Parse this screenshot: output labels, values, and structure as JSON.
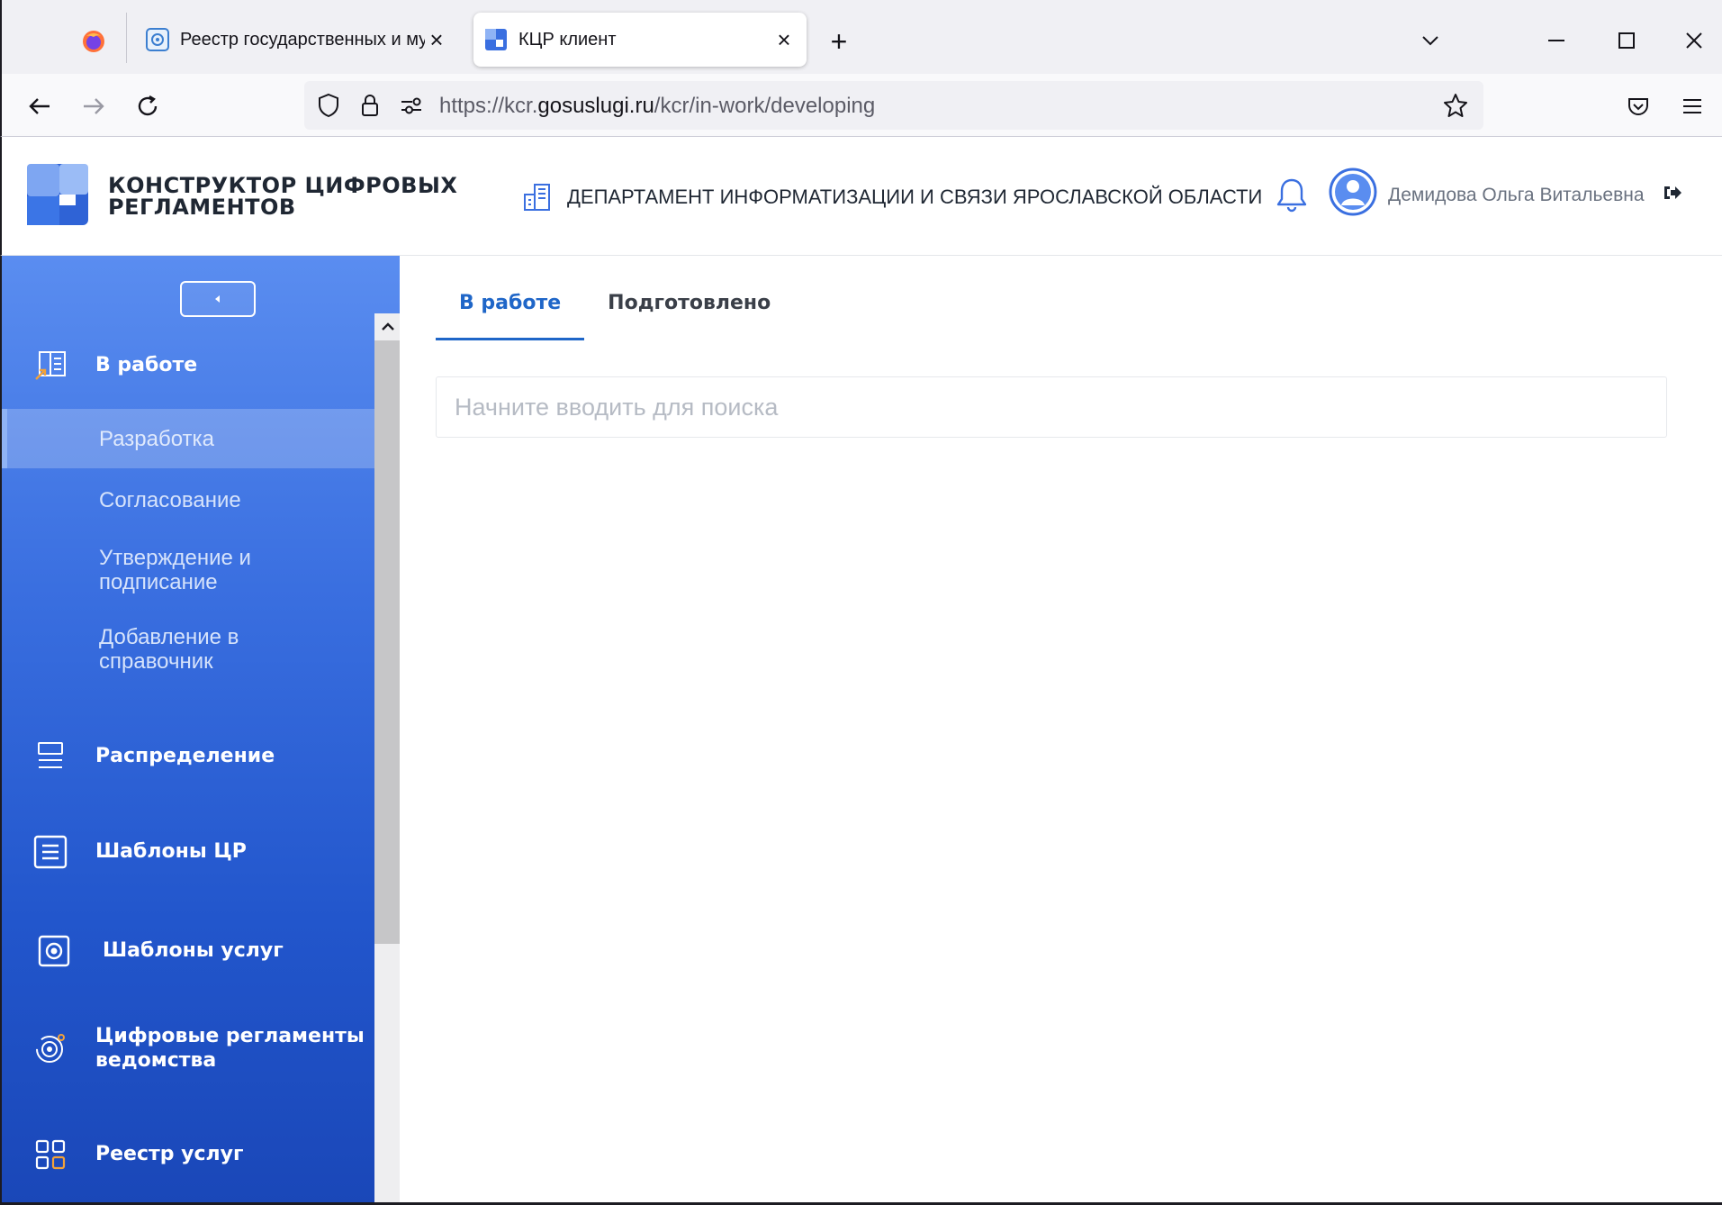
{
  "browser": {
    "tabs": [
      {
        "title": "Реестр государственных и муниципальных",
        "active": false
      },
      {
        "title": "КЦР клиент",
        "active": true
      }
    ],
    "url_prefix": "https://kcr.",
    "url_domain": "gosuslugi.ru",
    "url_path": "/kcr/in-work/developing"
  },
  "header": {
    "brand_line1": "КОНСТРУКТОР ЦИФРОВЫХ",
    "brand_line2": "РЕГЛАМЕНТОВ",
    "department": "ДЕПАРТАМЕНТ ИНФОРМАТИЗАЦИИ И СВЯЗИ ЯРОСЛАВСКОЙ ОБЛАСТИ",
    "user_name": "Демидова Ольга Витальевна"
  },
  "sidebar": {
    "in_work": {
      "label": "В работе"
    },
    "sub_items": [
      {
        "line1": "Разработка",
        "line2": ""
      },
      {
        "line1": "Согласование",
        "line2": ""
      },
      {
        "line1": "Утверждение и",
        "line2": "подписание"
      },
      {
        "line1": "Добавление в",
        "line2": "справочник"
      }
    ],
    "items": [
      {
        "line1": "Распределение",
        "line2": ""
      },
      {
        "line1": "Шаблоны ЦР",
        "line2": ""
      },
      {
        "line1": "Шаблоны услуг",
        "line2": ""
      },
      {
        "line1": "Цифровые регламенты",
        "line2": "ведомства"
      },
      {
        "line1": "Реестр услуг",
        "line2": ""
      }
    ]
  },
  "main": {
    "tabs": [
      {
        "label": "В работе",
        "active": true
      },
      {
        "label": "Подготовлено",
        "active": false
      }
    ],
    "search": {
      "placeholder": "Начните вводить для поиска",
      "value": ""
    }
  },
  "colors": {
    "accent": "#1f66c8",
    "sidebar_top": "#5a8df0",
    "sidebar_bottom": "#1a47b8"
  }
}
